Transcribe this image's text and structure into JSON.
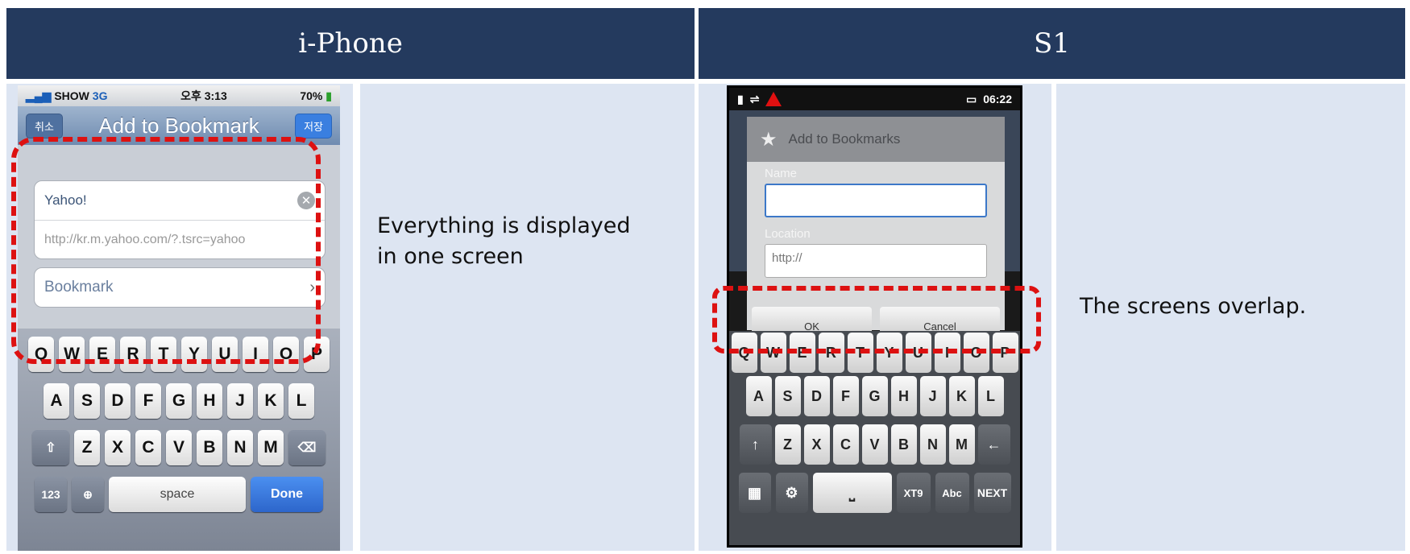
{
  "headers": {
    "left": "i-Phone",
    "right": "S1"
  },
  "captions": {
    "iphone_line1": "Everything is displayed",
    "iphone_line2": "in one screen",
    "s1": "The screens overlap."
  },
  "iphone": {
    "status": {
      "carrier": "SHOW",
      "network": "3G",
      "time": "오후 3:13",
      "battery": "70%"
    },
    "nav": {
      "cancel": "취소",
      "title": "Add to Bookmark",
      "save": "저장"
    },
    "name_value": "Yahoo!",
    "url_value": "http://kr.m.yahoo.com/?.tsrc=yahoo",
    "folder": "Bookmark",
    "keyboard": {
      "row1": [
        "Q",
        "W",
        "E",
        "R",
        "T",
        "Y",
        "U",
        "I",
        "O",
        "P"
      ],
      "row2": [
        "A",
        "S",
        "D",
        "F",
        "G",
        "H",
        "J",
        "K",
        "L"
      ],
      "row3": [
        "Z",
        "X",
        "C",
        "V",
        "B",
        "N",
        "M"
      ],
      "num": "123",
      "space": "space",
      "done": "Done"
    }
  },
  "s1": {
    "status_time": "06:22",
    "dialog_title": "Add to Bookmarks",
    "name_label": "Name",
    "location_label": "Location",
    "location_value": "http://",
    "ok": "OK",
    "cancel": "Cancel",
    "keyboard": {
      "row1": [
        "Q",
        "W",
        "E",
        "R",
        "T",
        "Y",
        "U",
        "I",
        "O",
        "P"
      ],
      "row2": [
        "A",
        "S",
        "D",
        "F",
        "G",
        "H",
        "J",
        "K",
        "L"
      ],
      "row3": [
        "Z",
        "X",
        "C",
        "V",
        "B",
        "N",
        "M"
      ],
      "xt9": "XT9",
      "abc": "Abc",
      "next": "NEXT"
    }
  },
  "colors": {
    "header": "#243a5e",
    "panel": "#dde5f2",
    "highlight": "#dd1111"
  }
}
